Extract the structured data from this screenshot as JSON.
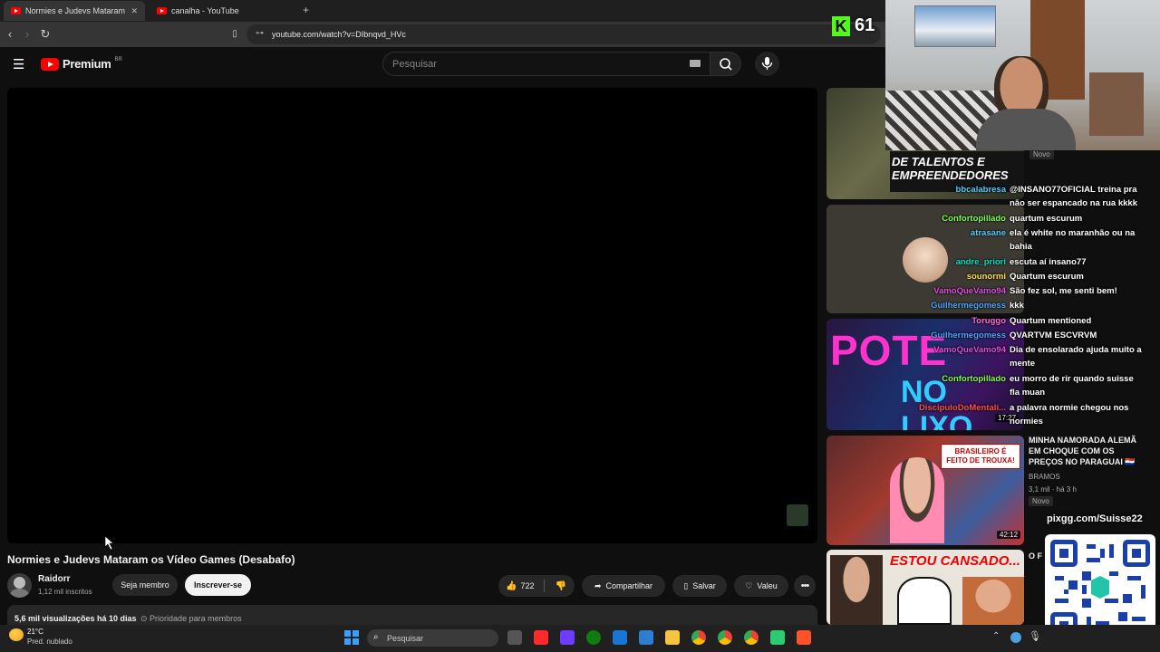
{
  "browser": {
    "tabs": [
      {
        "label": "Normies e Judevs Mataram os V",
        "active": true
      },
      {
        "label": "canalha - YouTube",
        "active": false
      }
    ],
    "new_tab": "+",
    "close": "✕",
    "url": "youtube.com/watch?v=DIbnqvd_HVc"
  },
  "youtube": {
    "brand": "Premium",
    "region": "BR",
    "search_placeholder": "Pesquisar",
    "video": {
      "title": "Normies e Judevs Mataram os Vídeo Games (Desabafo)",
      "channel": "Raidorr",
      "subscribers": "1,12 mil inscritos",
      "member_label": "Seja membro",
      "subscribe_label": "Inscrever-se",
      "likes": "722",
      "share_label": "Compartilhar",
      "save_label": "Salvar",
      "thanks_label": "Valeu",
      "views": "5,6 mil visualizações",
      "age": "há 10 dias",
      "priority": "Prioridade para membros"
    },
    "sidebar": [
      {
        "badge": "Novo"
      },
      {
        "duration": "17:27"
      },
      {
        "title": "MINHA NAMORADA ALEMÃ EM CHOQUE COM OS PREÇOS NO PARAGUAI 🇵🇾",
        "channel": "BRAMOS",
        "meta": "3,1 mil · há 3 h",
        "badge": "Novo",
        "duration": "42:12",
        "thumb_text": "BRASILEIRO É FEITO DE TROUXA!"
      },
      {
        "thumb_text": "ESTOU CANSADO...",
        "title": "O F"
      }
    ]
  },
  "overlay": {
    "counter": "61",
    "qr_label": "pixgg.com/Suisse22",
    "thumb_banner": "DE TALENTOS E EMPREENDEDORES",
    "thumb_potential": "POTE",
    "thumb_nolixo": "NO LIXO"
  },
  "chat": [
    {
      "user": "bbcalabresa",
      "msg": "@INSANO77OFICIAL treina pra não ser espancado na rua kkkk",
      "color": "#4dd0ff"
    },
    {
      "user": "Confortopillado",
      "msg": "quartum escurum",
      "color": "#7cff4d"
    },
    {
      "user": "atrasane",
      "msg": "ela é white no maranhão ou na bahia",
      "color": "#4dd0ff"
    },
    {
      "user": "andre_priori",
      "msg": "escuta aí insano77",
      "color": "#00e5c8"
    },
    {
      "user": "sounormi",
      "msg": "Quartum escurum",
      "color": "#ffe14d"
    },
    {
      "user": "VamoQueVamo94",
      "msg": "São fez sol, me senti bem!",
      "color": "#e04de0"
    },
    {
      "user": "Guilhermegomess",
      "msg": "kkk",
      "color": "#4da6ff"
    },
    {
      "user": "Toruggo",
      "msg": "Quartum mentioned",
      "color": "#ff6ad5"
    },
    {
      "user": "Guilhermegomess",
      "msg": "QVARTVM ESCVRVM",
      "color": "#4da6ff"
    },
    {
      "user": "VamoQueVamo94",
      "msg": "Dia de ensolarado ajuda muito a mente",
      "color": "#e04de0"
    },
    {
      "user": "Confortopillado",
      "msg": "eu morro de rir quando suisse fla muan",
      "color": "#7cff4d"
    },
    {
      "user": "DiscipuloDoMentali...",
      "msg": "a palavra normie chegou nos normies",
      "color": "#ff4d4d"
    }
  ],
  "taskbar": {
    "temp": "21°C",
    "weather": "Pred. nublado",
    "search": "Pesquisar"
  },
  "colors": {
    "accent_red": "#ff0000",
    "bg": "#0f0f0f",
    "kick_green": "#53fc18"
  }
}
